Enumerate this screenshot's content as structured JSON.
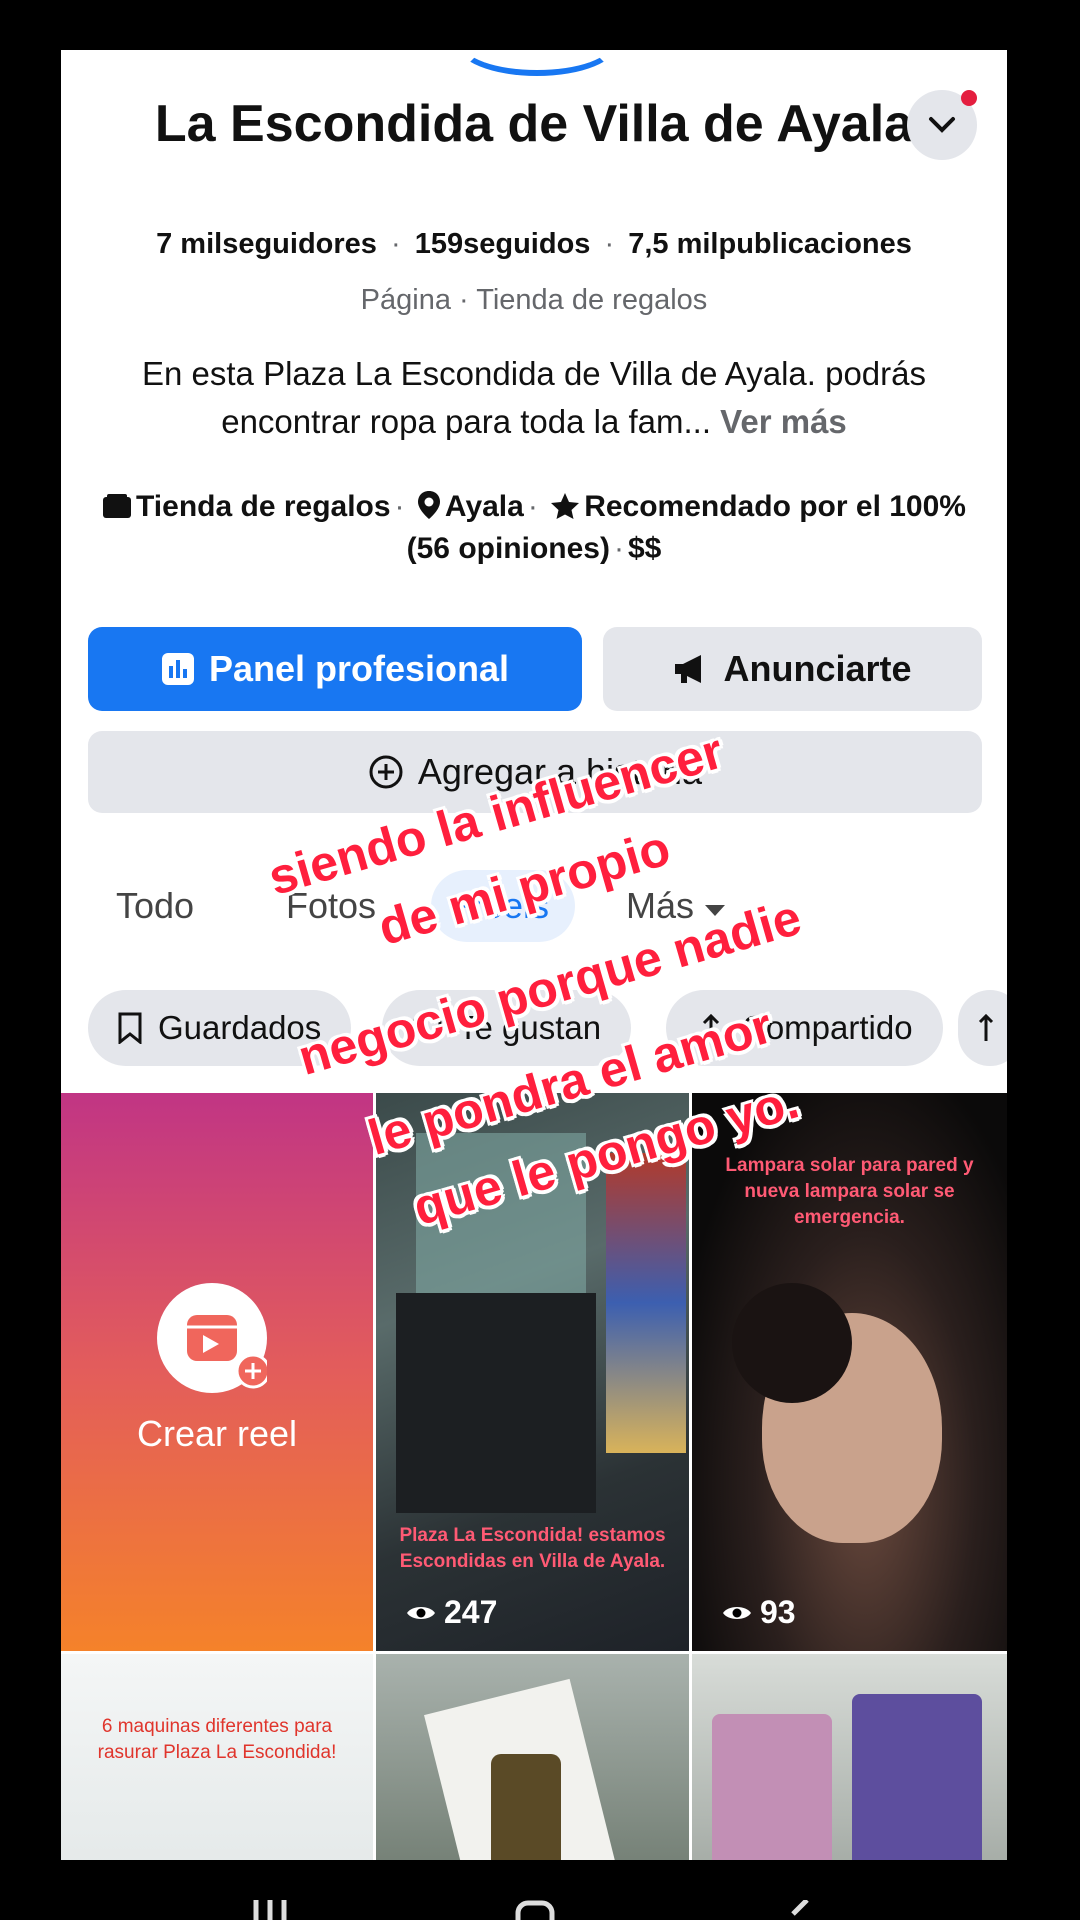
{
  "page": {
    "name": "La Escondida de Villa de Ayala",
    "stats": {
      "followers": "7 milseguidores",
      "following": "159seguidos",
      "posts": "7,5 milpublicaciones",
      "separator": "·"
    },
    "category_line": "Página · Tienda de regalos",
    "bio": "En esta Plaza La Escondida de Villa de Ayala. podrás encontrar ropa para toda la fam...",
    "bio_more": "Ver más",
    "details": {
      "category": "Tienda de regalos",
      "location": "Ayala",
      "rating": "Recomendado por el 100% (56 opiniones)",
      "price": "$$"
    }
  },
  "actions": {
    "primary": "Panel profesional",
    "ads": "Anunciarte",
    "add": "Agregar a historia"
  },
  "tabs": [
    {
      "label": "Todo"
    },
    {
      "label": "Fotos"
    },
    {
      "label": "Reels"
    },
    {
      "label": "Más"
    }
  ],
  "chips": [
    {
      "label": "Guardados",
      "icon": "bookmark-icon"
    },
    {
      "label": "Te gustan",
      "icon": "heart-icon"
    },
    {
      "label": "Compartido",
      "icon": "share-icon"
    }
  ],
  "reels": {
    "create_label": "Crear reel",
    "items": [
      {
        "caption": "Plaza La Escondida! estamos Escondidas en Villa de Ayala.",
        "views": "247"
      },
      {
        "caption": "Lampara solar para pared y nueva lampara solar se emergencia.",
        "views": "93"
      },
      {
        "caption": "6 maquinas diferentes para rasurar Plaza La Escondida!",
        "views": ""
      }
    ]
  },
  "overlay_text": [
    "siendo la influencer",
    "de mi propio",
    "negocio porque nadie",
    "le pondra el amor",
    "que le pongo yo."
  ],
  "colors": {
    "primary": "#1877f2",
    "overlay_text": "#ff1f3d",
    "notification_dot": "#e41e3f"
  }
}
